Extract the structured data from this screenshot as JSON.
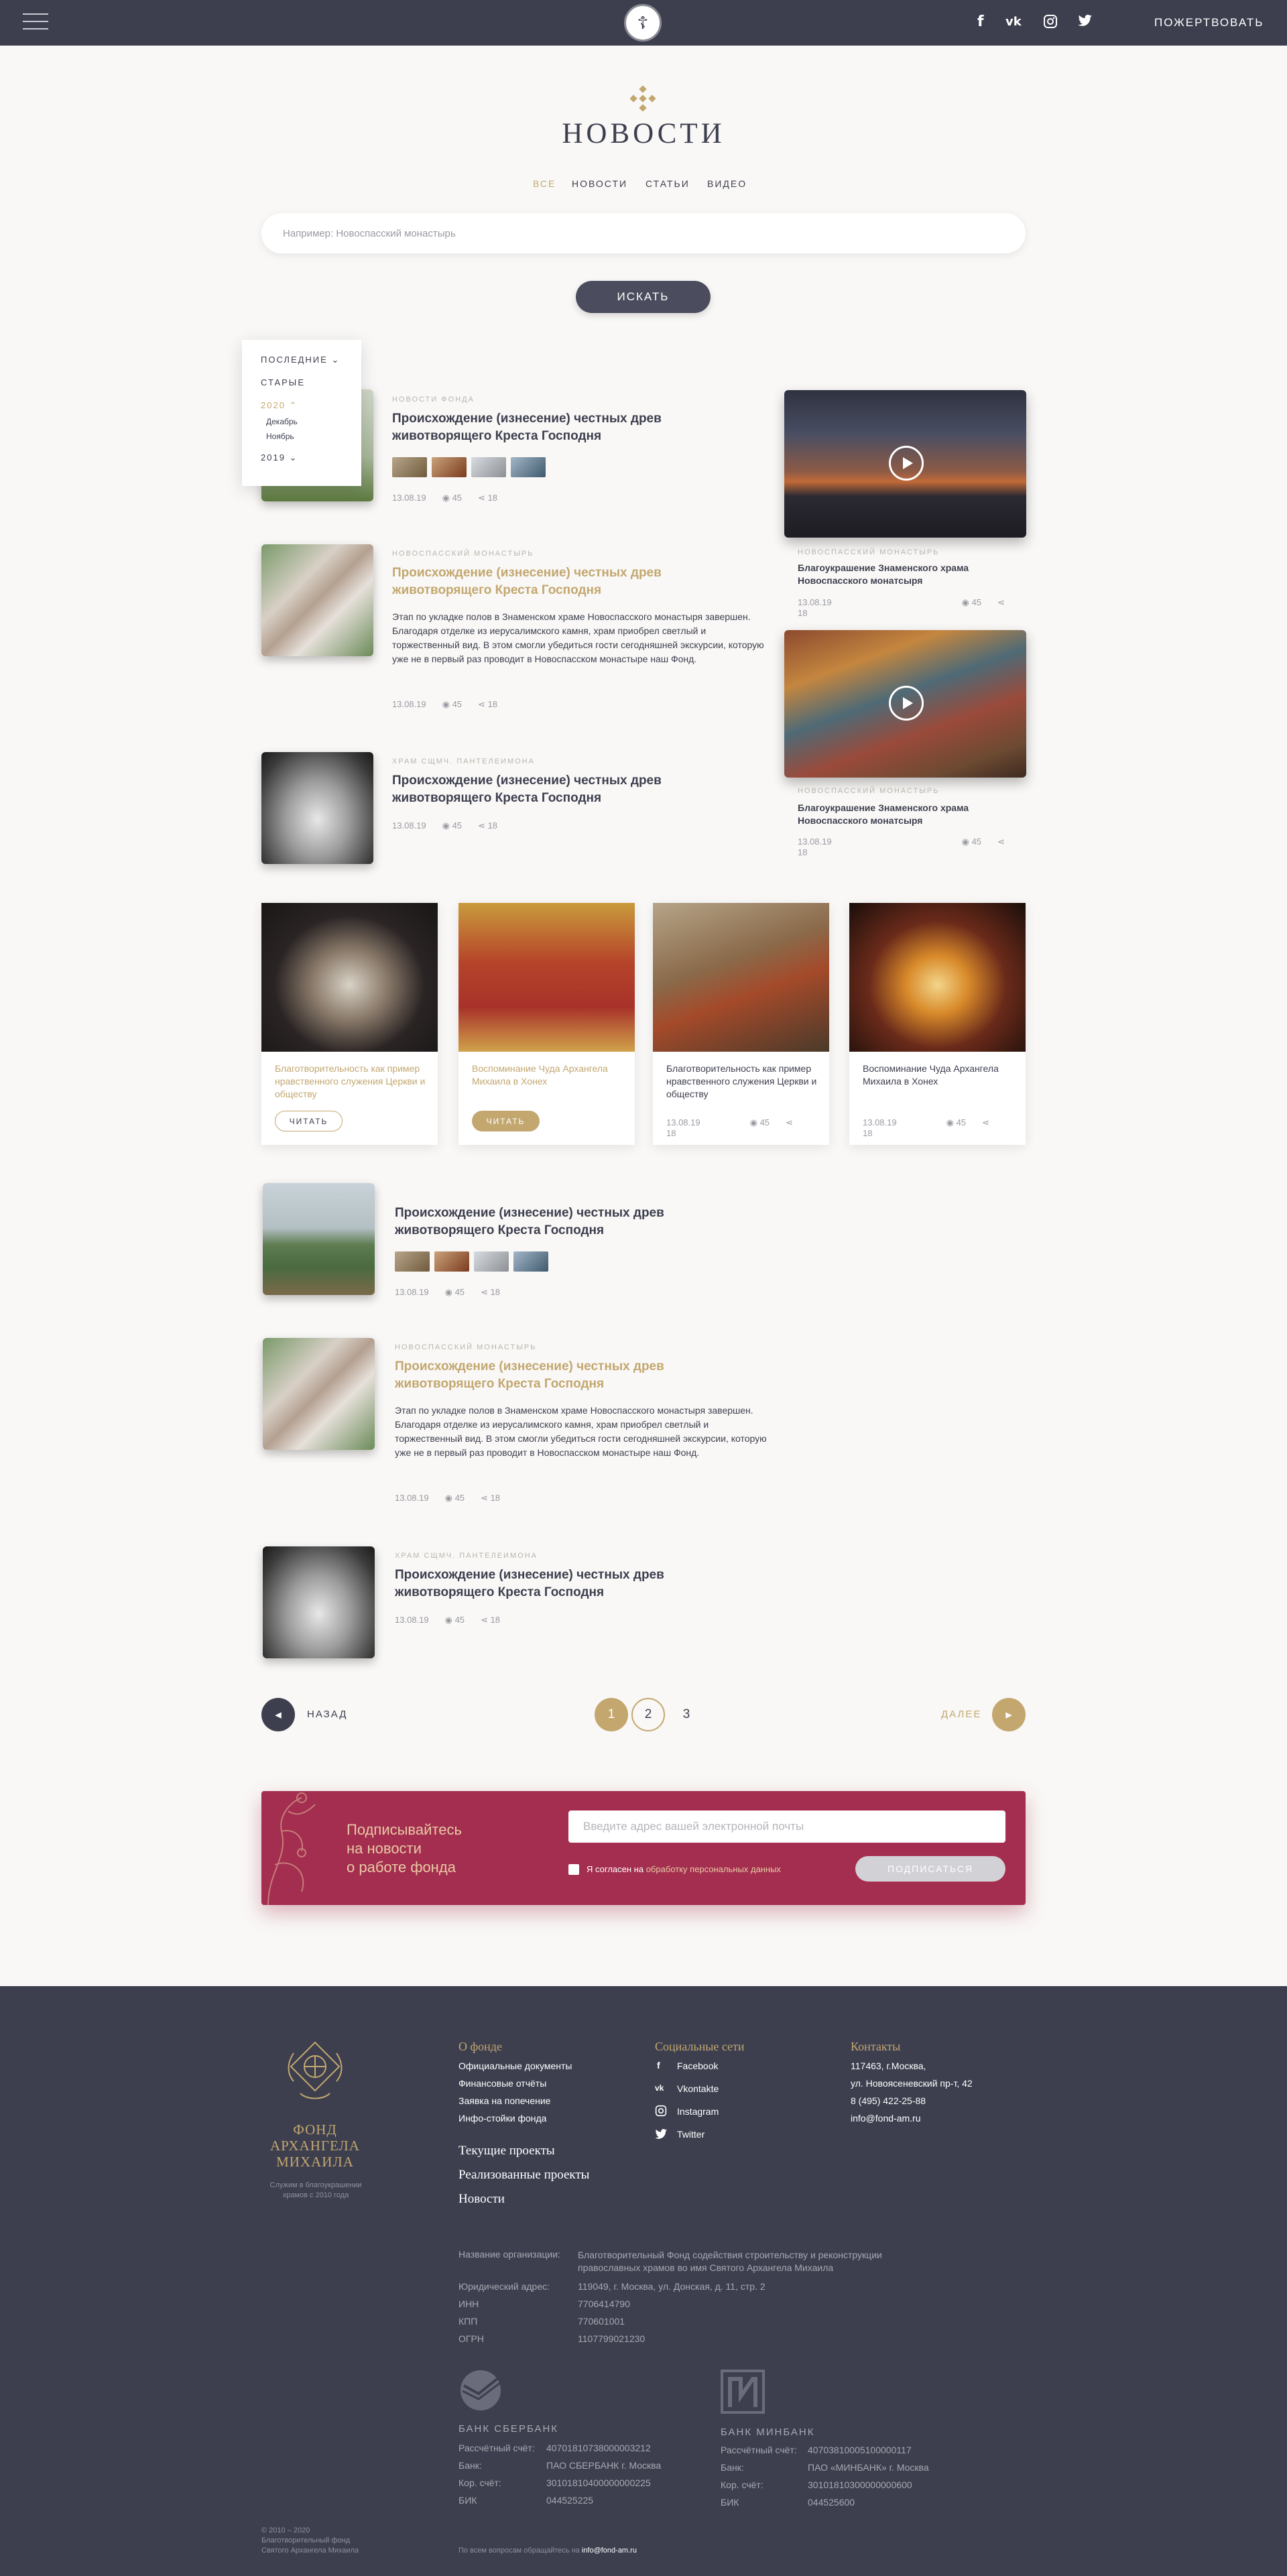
{
  "header": {
    "social": [
      "f",
      "vk",
      "ig",
      "tw"
    ],
    "donate_label": "ПОЖЕРТВОВАТЬ"
  },
  "page_title": "НОВОСТИ",
  "filter_tabs": [
    "ВСЕ",
    "НОВОСТИ",
    "СТАТЬИ",
    "ВИДЕО"
  ],
  "search": {
    "placeholder": "Например: Новоспасский монастырь",
    "button": "ИСКАТЬ"
  },
  "sort": {
    "latest": "ПОСЛЕДНИЕ",
    "old": "СТАРЫЕ",
    "year2020": "2020",
    "month1": "Декабрь",
    "month2": "Ноябрь",
    "year2019": "2019"
  },
  "news": [
    {
      "category": "НОВОСТИ ФОНДА",
      "title": "Происхождение (изнесение) честных древ животворящего Креста Господня",
      "date": "13.08.19",
      "views": "45",
      "shares": "18"
    },
    {
      "category": "НОВОСПАССКИЙ МОНАСТЫРЬ",
      "title": "Происхождение (изнесение) честных древ животворящего Креста Господня",
      "excerpt": "Этап по укладке полов в Знаменском храме Новоспасского монастыря завершен. Благодаря отделке из иерусалимского камня, храм приобрел светлый и торжественный вид. В этом смогли убедиться гости сегодняшней экскурсии, которую уже не в первый раз проводит в Новоспасском монастыре наш Фонд.",
      "date": "13.08.19",
      "views": "45",
      "shares": "18"
    },
    {
      "category": "ХРАМ СЩМЧ. ПАНТЕЛЕИМОНА",
      "title": "Происхождение (изнесение) честных древ животворящего Креста Господня",
      "date": "13.08.19",
      "views": "45",
      "shares": "18"
    }
  ],
  "videos": [
    {
      "category": "НОВОСПАССКИЙ МОНАСТЫРЬ",
      "title": "Благоукрашение Знаменского храма Новоспасского монатсыря",
      "date": "13.08.19",
      "views": "45",
      "shares": "18"
    },
    {
      "category": "НОВОСПАССКИЙ МОНАСТЫРЬ",
      "title": "Благоукрашение Знаменского храма Новоспасского монатсыря",
      "date": "13.08.19",
      "views": "45",
      "shares": "18"
    }
  ],
  "cards": [
    {
      "title": "Благотворительность как пример нравственного служения Церкви и обществу",
      "button": "ЧИТАТЬ"
    },
    {
      "title": "Воспоминание Чуда Архангела Михаила в Хонех",
      "button": "ЧИТАТЬ"
    },
    {
      "title": "Благотворительность как пример нравственного служения Церкви и обществу",
      "date": "13.08.19",
      "views": "45",
      "shares": "18"
    },
    {
      "title": "Воспоминание Чуда Архангела Михаила в Хонех",
      "date": "13.08.19",
      "views": "45",
      "shares": "18"
    }
  ],
  "news2": [
    {
      "title": "Происхождение (изнесение) честных древ животворящего Креста Господня",
      "date": "13.08.19",
      "views": "45",
      "shares": "18"
    },
    {
      "category": "НОВОСПАССКИЙ МОНАСТЫРЬ",
      "title": "Происхождение (изнесение) честных древ животворящего Креста Господня",
      "excerpt": "Этап по укладке полов в Знаменском храме Новоспасского монастыря завершен. Благодаря отделке из иерусалимского камня, храм приобрел светлый и торжественный вид. В этом смогли убедиться гости сегодняшней экскурсии, которую уже не в первый раз проводит в Новоспасском монастыре наш Фонд.",
      "date": "13.08.19",
      "views": "45",
      "shares": "18"
    },
    {
      "category": "ХРАМ СЩМЧ. ПАНТЕЛЕИМОНА",
      "title": "Происхождение (изнесение) честных древ животворящего Креста Господня",
      "date": "13.08.19",
      "views": "45",
      "shares": "18"
    }
  ],
  "pagination": {
    "prev": "НАЗАД",
    "next": "ДАЛЕЕ",
    "pages": [
      "1",
      "2",
      "3"
    ],
    "current": "1"
  },
  "subscribe": {
    "text_line1": "Подписывайтесь",
    "text_line2": "на новости",
    "text_line3": "о работе фонда",
    "placeholder": "Введите адрес вашей электронной почты",
    "agree_prefix": "Я согласен на",
    "agree_link": "обработку персональных данных",
    "button": "ПОДПИСАТЬСЯ"
  },
  "footer": {
    "logo_name": "ФОНД АРХАНГЕЛА МИХАИЛА",
    "logo_sub": "Служим в благоукрашении храмов с 2010 года",
    "about_title": "О фонде",
    "about_links": [
      "Официальные документы",
      "Финансовые отчёты",
      "Заявка на попечение",
      "Инфо-стойки фонда"
    ],
    "big_links": [
      "Текущие проекты",
      "Реализованные проекты",
      "Новости"
    ],
    "social_title": "Социальные сети",
    "social_links": [
      "Facebook",
      "Vkontakte",
      "Instagram",
      "Twitter"
    ],
    "contacts_title": "Контакты",
    "contacts": [
      "117463, г.Москва,",
      "ул. Новоясеневский пр-т, 42",
      "8 (495) 422-25-88",
      "info@fond-am.ru"
    ],
    "org": [
      {
        "label": "Название организации:",
        "value": "Благотворительный Фонд содействия строительству и реконструкции православных храмов во имя Святого Архангела Михаила"
      },
      {
        "label": "Юридический адрес:",
        "value": "119049, г. Москва, ул. Донская, д. 11, стр. 2"
      },
      {
        "label": "ИНН",
        "value": "7706414790"
      },
      {
        "label": "КПП",
        "value": "770601001"
      },
      {
        "label": "ОГРН",
        "value": "1107799021230"
      }
    ],
    "banks": [
      {
        "name": "БАНК СБЕРБАНК",
        "rows": [
          {
            "label": "Рассчётный счёт:",
            "value": "40701810738000003212"
          },
          {
            "label": "Банк:",
            "value": "ПАО СБЕРБАНК г. Москва"
          },
          {
            "label": "Кор. счёт:",
            "value": "30101810400000000225"
          },
          {
            "label": "БИК",
            "value": "044525225"
          }
        ]
      },
      {
        "name": "БАНК МИНБАНК",
        "rows": [
          {
            "label": "Рассчётный счёт:",
            "value": "40703810005100000117"
          },
          {
            "label": "Банк:",
            "value": "ПАО «МИНБАНК» г. Москва"
          },
          {
            "label": "Кор. счёт:",
            "value": "30101810300000000600"
          },
          {
            "label": "БИК",
            "value": "044525600"
          }
        ]
      }
    ],
    "copyright": "© 2010 – 2020",
    "copyright2": "Благотворительный фонд",
    "copyright3": "Святого Архангела Михаила",
    "contact_note": "По всем вопросам обращайтесь на",
    "contact_email": "info@fond-am.ru"
  },
  "colors": {
    "accent": "#c3a76f",
    "dark": "#3d3f4f",
    "subscribe_bg": "#a32e4f"
  }
}
